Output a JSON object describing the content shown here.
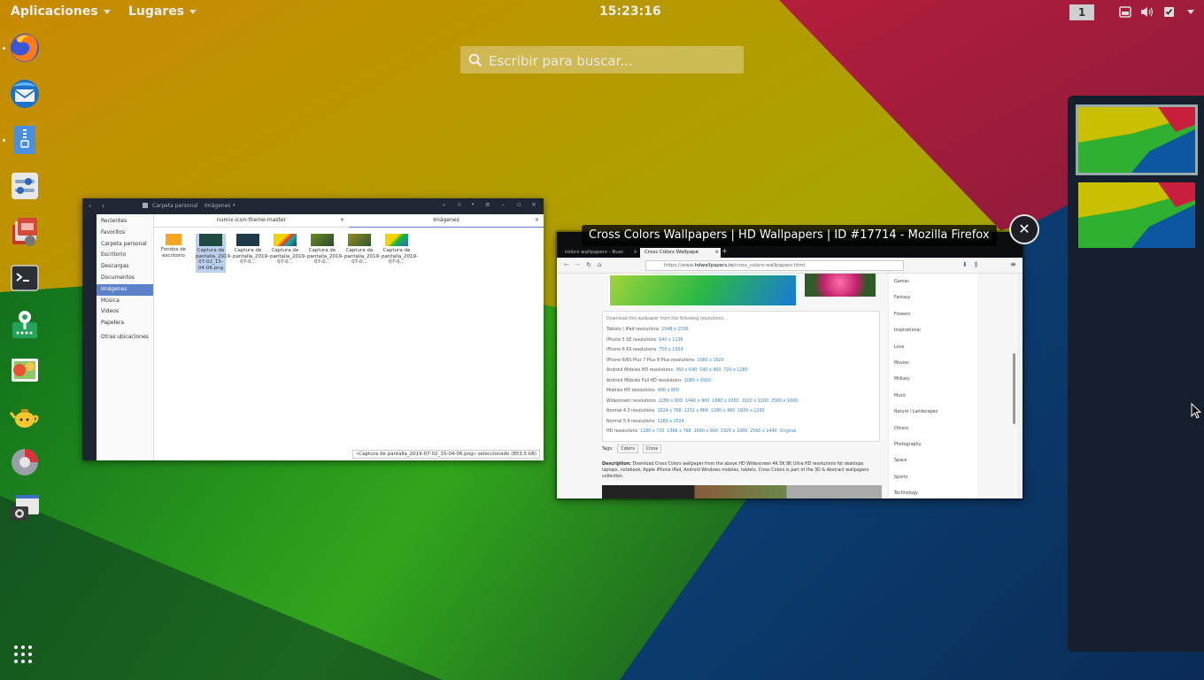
{
  "topbar": {
    "applications": "Aplicaciones",
    "places": "Lugares",
    "clock": "15:23:16",
    "workspace_indicator": "1",
    "tray_icons": [
      "keyboard-icon",
      "volume-icon",
      "clipboard-check-icon",
      "chevron-down-icon"
    ]
  },
  "search": {
    "placeholder": "Escribir para buscar..."
  },
  "dock": {
    "apps": [
      "firefox",
      "thunderbird",
      "archive-manager",
      "settings",
      "software-install",
      "terminal",
      "password-keyring",
      "image-viewer",
      "teapot",
      "disk-usage",
      "screenshot"
    ]
  },
  "files_window": {
    "path_root": "Carpeta personal",
    "path_current": "Imágenes",
    "places": [
      "Recientes",
      "Favoritos",
      "Carpeta personal",
      "Escritorio",
      "Descargas",
      "Documentos",
      "Imágenes",
      "Música",
      "Vídeos",
      "Papelera",
      "Otras ubicaciones"
    ],
    "selected_place": "Imágenes",
    "tabs": [
      "numix-icon-theme-master",
      "Imágenes"
    ],
    "items": [
      {
        "name": "Fondos de escritorio"
      },
      {
        "name": "Captura de pantalla_2019-07-02_15-04-06.png"
      },
      {
        "name": "Captura de pantalla_2019-07-0..."
      },
      {
        "name": "Captura de pantalla_2019-07-0..."
      },
      {
        "name": "Captura de pantalla_2019-07-0..."
      },
      {
        "name": "Captura de pantalla_2019-07-0..."
      },
      {
        "name": "Captura de pantalla_2019-07-0..."
      }
    ],
    "status": "«Captura de pantalla_2019-07-02_15-04-06.png» seleccionado (853,5 kB)"
  },
  "firefox_window": {
    "title": "Cross Colors Wallpapers | HD Wallpapers | ID #17714 - Mozilla Firefox",
    "tabs": [
      "colors wallpapers - Busc",
      "Cross Colors Wallpape"
    ],
    "url_prefix": "https://www.",
    "url_domain": "hdwallpapers.in",
    "url_path": "/cross_colors-wallpapers.html",
    "download_heading": "Download this wallpaper from the following resolutions...",
    "resolutions": [
      {
        "label": "Tablets | iPad resolutions",
        "links": [
          "2048 x 1536"
        ]
      },
      {
        "label": "iPhone 5 SE resolutions",
        "links": [
          "640 x 1136"
        ]
      },
      {
        "label": "iPhone 6 6S resolutions",
        "links": [
          "750 x 1334"
        ]
      },
      {
        "label": "iPhone 6/6S Plus 7 Plus 8 Plus resolutions",
        "links": [
          "1080 x 1920"
        ]
      },
      {
        "label": "Android Mobiles HD resolutions",
        "links": [
          "360 x 640",
          "540 x 960",
          "720 x 1280"
        ]
      },
      {
        "label": "Android Mobiles Full HD resolutions",
        "links": [
          "1080 x 1920"
        ]
      },
      {
        "label": "Mobiles HD resolutions",
        "links": [
          "480 x 800"
        ]
      },
      {
        "label": "Widescreen resolutions",
        "links": [
          "1280 x 800",
          "1440 x 900",
          "1680 x 1050",
          "1920 x 1200",
          "2560 x 1600"
        ]
      },
      {
        "label": "Normal 4:3 resolutions",
        "links": [
          "1024 x 768",
          "1152 x 864",
          "1280 x 960",
          "1600 x 1200"
        ]
      },
      {
        "label": "Normal 5:4 resolutions",
        "links": [
          "1280 x 1024"
        ]
      },
      {
        "label": "HD resolutions",
        "links": [
          "1280 x 720",
          "1366 x 768",
          "1600 x 900",
          "1920 x 1080",
          "2560 x 1440",
          "Original"
        ]
      }
    ],
    "tags_label": "Tags:",
    "tags": [
      "Colors",
      "Cross"
    ],
    "description_label": "Description:",
    "description": "Download Cross Colors wallpaper from the above HD Widescreen 4K 5K 8K Ultra HD resolutions for desktops laptops, notebook, Apple iPhone iPad, Android Windows mobiles, tablets. Cross Colors is part of the 3D & Abstract wallpapers collection.",
    "categories": [
      "Games",
      "Fantasy",
      "Flowers",
      "Inspirational",
      "Love",
      "Movies",
      "Military",
      "Music",
      "Nature / Landscapes",
      "Others",
      "Photography",
      "Space",
      "Sports",
      "Technology"
    ]
  },
  "workspaces": {
    "count": 2,
    "active": 1
  },
  "colors": {
    "topbar_bg": "#000000",
    "dash_bg": "#1a1f2b",
    "accent": "#5a81c9"
  }
}
